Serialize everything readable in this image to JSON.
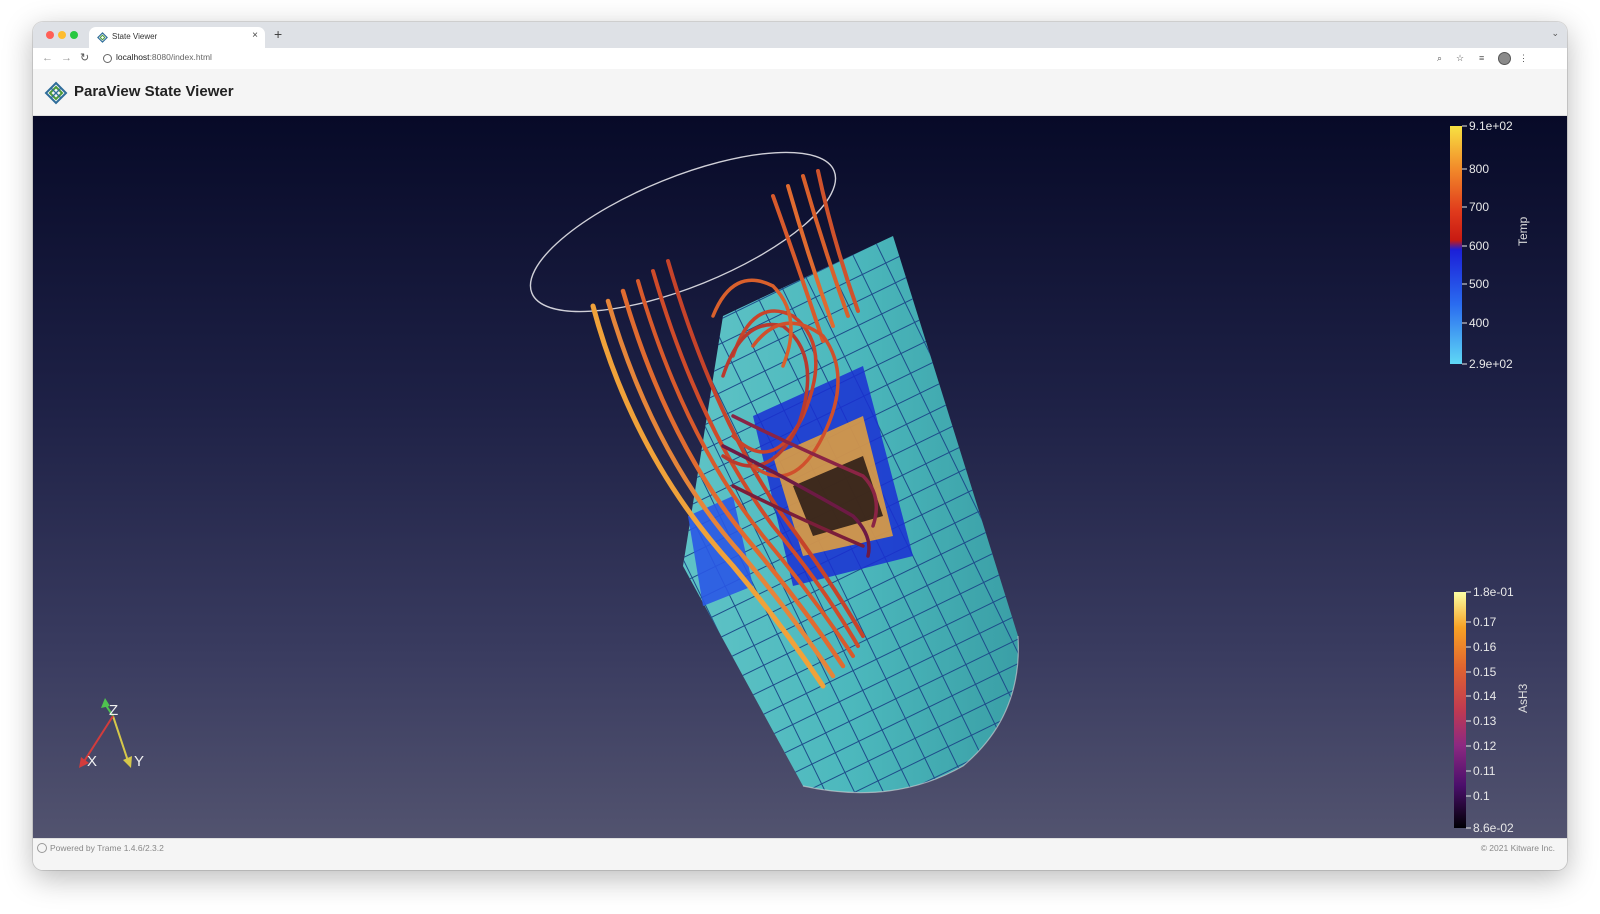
{
  "browser": {
    "tab_title": "State Viewer",
    "tab_close": "×",
    "new_tab": "+",
    "url_host": "localhost",
    "url_path": ":8080/index.html"
  },
  "app": {
    "title": "ParaView State Viewer"
  },
  "scalar_bars": {
    "temp": {
      "title": "Temp",
      "labels": [
        "9.1e+02",
        "800",
        "700",
        "600",
        "500",
        "400",
        "2.9e+02"
      ],
      "colors": [
        "#f7e142",
        "#f28a2a",
        "#e03a1c",
        "#c81a12",
        "#1b1fd8",
        "#2a6cf0",
        "#5fd8f5"
      ]
    },
    "ash3": {
      "title": "AsH3",
      "labels": [
        "1.8e-01",
        "0.17",
        "0.16",
        "0.15",
        "0.14",
        "0.13",
        "0.12",
        "0.11",
        "0.1",
        "8.6e-02"
      ],
      "colors": [
        "#fcffa4",
        "#f7a225",
        "#e1642f",
        "#c03a51",
        "#8c2981",
        "#4b0f6b",
        "#000004"
      ]
    }
  },
  "orientation_axes": {
    "x": "X",
    "y": "Y",
    "z": "Z"
  },
  "footer": {
    "powered_by": "Powered by Trame 1.4.6/2.3.2",
    "copyright": "© 2021 Kitware Inc."
  }
}
